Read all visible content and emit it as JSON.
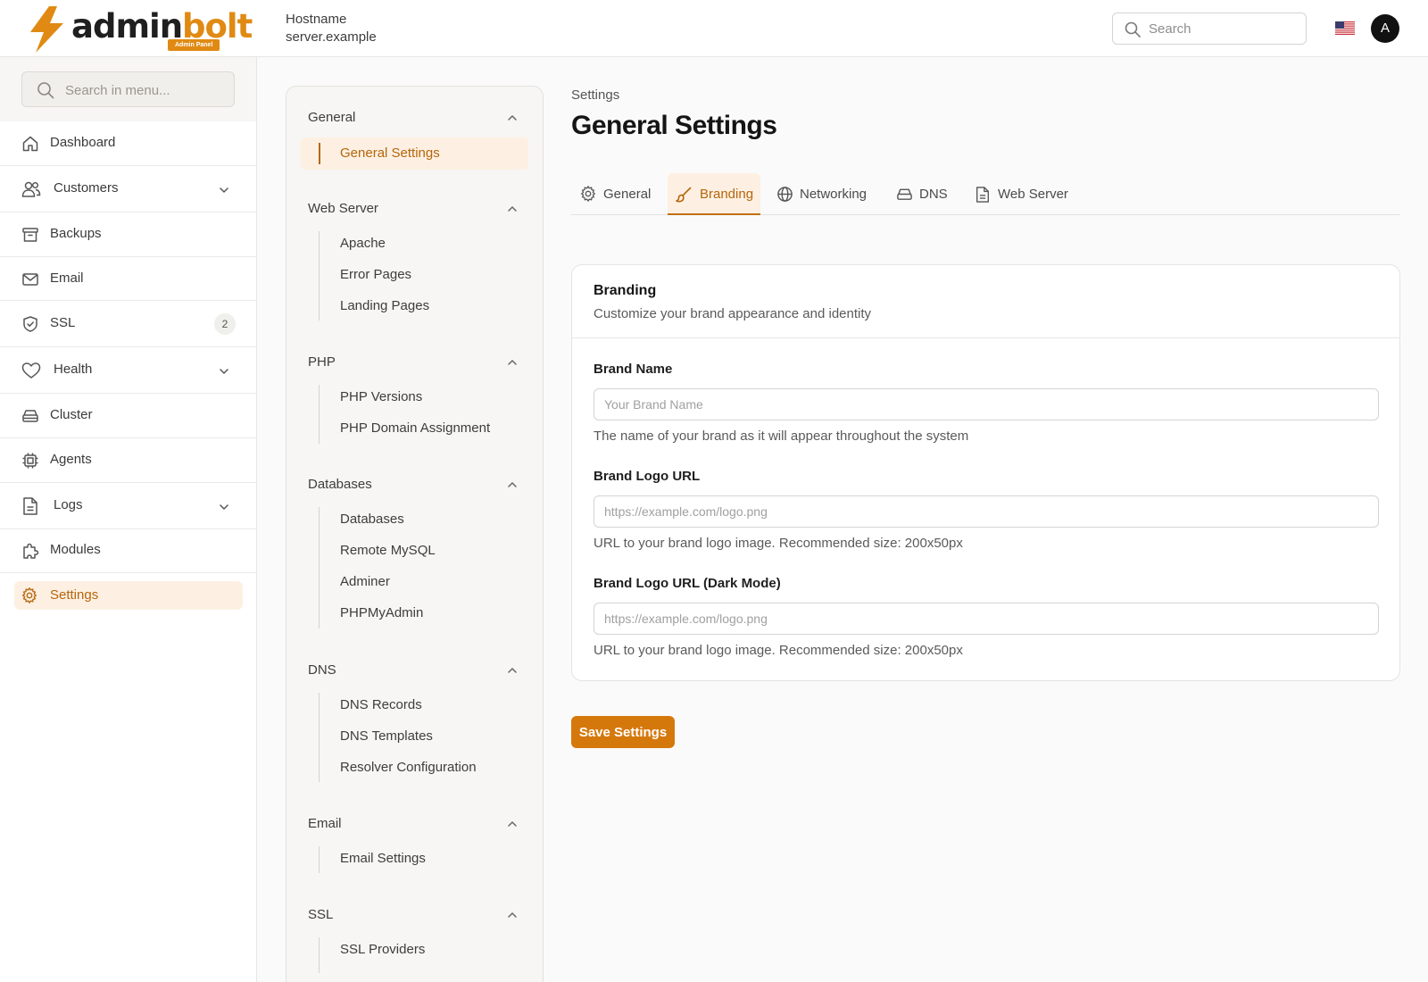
{
  "brand": {
    "word_dark": "admin",
    "word_accent": "bolt",
    "badge": "Admin Panel"
  },
  "header": {
    "hostname_label": "Hostname",
    "hostname_value": "server.example",
    "search_placeholder": "Search",
    "flag_icon": "us-flag-icon",
    "avatar_initial": "A"
  },
  "sidebar": {
    "search_placeholder": "Search in menu...",
    "items": [
      {
        "label": "Dashboard",
        "icon": "home-icon"
      },
      {
        "label": "Customers",
        "icon": "users-icon",
        "expandable": true
      },
      {
        "label": "Backups",
        "icon": "archive-icon"
      },
      {
        "label": "Email",
        "icon": "mail-icon"
      },
      {
        "label": "SSL",
        "icon": "shield-icon",
        "badge": "2"
      },
      {
        "label": "Health",
        "icon": "heart-icon",
        "expandable": true
      },
      {
        "label": "Cluster",
        "icon": "server-icon"
      },
      {
        "label": "Agents",
        "icon": "cpu-icon"
      },
      {
        "label": "Logs",
        "icon": "file-icon",
        "expandable": true
      },
      {
        "label": "Modules",
        "icon": "puzzle-icon"
      },
      {
        "label": "Settings",
        "icon": "gear-icon",
        "active": true
      }
    ]
  },
  "settings_nav": {
    "groups": [
      {
        "title": "General",
        "items": [
          "General Settings"
        ],
        "active_item": "General Settings"
      },
      {
        "title": "Web Server",
        "items": [
          "Apache",
          "Error Pages",
          "Landing Pages"
        ]
      },
      {
        "title": "PHP",
        "items": [
          "PHP Versions",
          "PHP Domain Assignment"
        ]
      },
      {
        "title": "Databases",
        "items": [
          "Databases",
          "Remote MySQL",
          "Adminer",
          "PHPMyAdmin"
        ]
      },
      {
        "title": "DNS",
        "items": [
          "DNS Records",
          "DNS Templates",
          "Resolver Configuration"
        ]
      },
      {
        "title": "Email",
        "items": [
          "Email Settings"
        ]
      },
      {
        "title": "SSL",
        "items": [
          "SSL Providers"
        ]
      }
    ]
  },
  "page": {
    "breadcrumb": "Settings",
    "title": "General Settings",
    "tabs": [
      {
        "label": "General",
        "icon": "gear-icon"
      },
      {
        "label": "Branding",
        "icon": "brush-icon",
        "active": true
      },
      {
        "label": "Networking",
        "icon": "globe-icon"
      },
      {
        "label": "DNS",
        "icon": "hard-drive-icon"
      },
      {
        "label": "Web Server",
        "icon": "document-icon"
      }
    ]
  },
  "branding_card": {
    "title": "Branding",
    "subtitle": "Customize your brand appearance and identity",
    "fields": [
      {
        "label": "Brand Name",
        "placeholder": "Your Brand Name",
        "value": "",
        "help": "The name of your brand as it will appear throughout the system"
      },
      {
        "label": "Brand Logo URL",
        "placeholder": "https://example.com/logo.png",
        "value": "",
        "help": "URL to your brand logo image. Recommended size: 200x50px"
      },
      {
        "label": "Brand Logo URL (Dark Mode)",
        "placeholder": "https://example.com/logo.png",
        "value": "",
        "help": "URL to your brand logo image. Recommended size: 200x50px"
      }
    ]
  },
  "actions": {
    "save_label": "Save Settings"
  },
  "colors": {
    "accent": "#d5780c",
    "accent_text": "#b6650c",
    "accent_bg": "#fdf0e2"
  }
}
